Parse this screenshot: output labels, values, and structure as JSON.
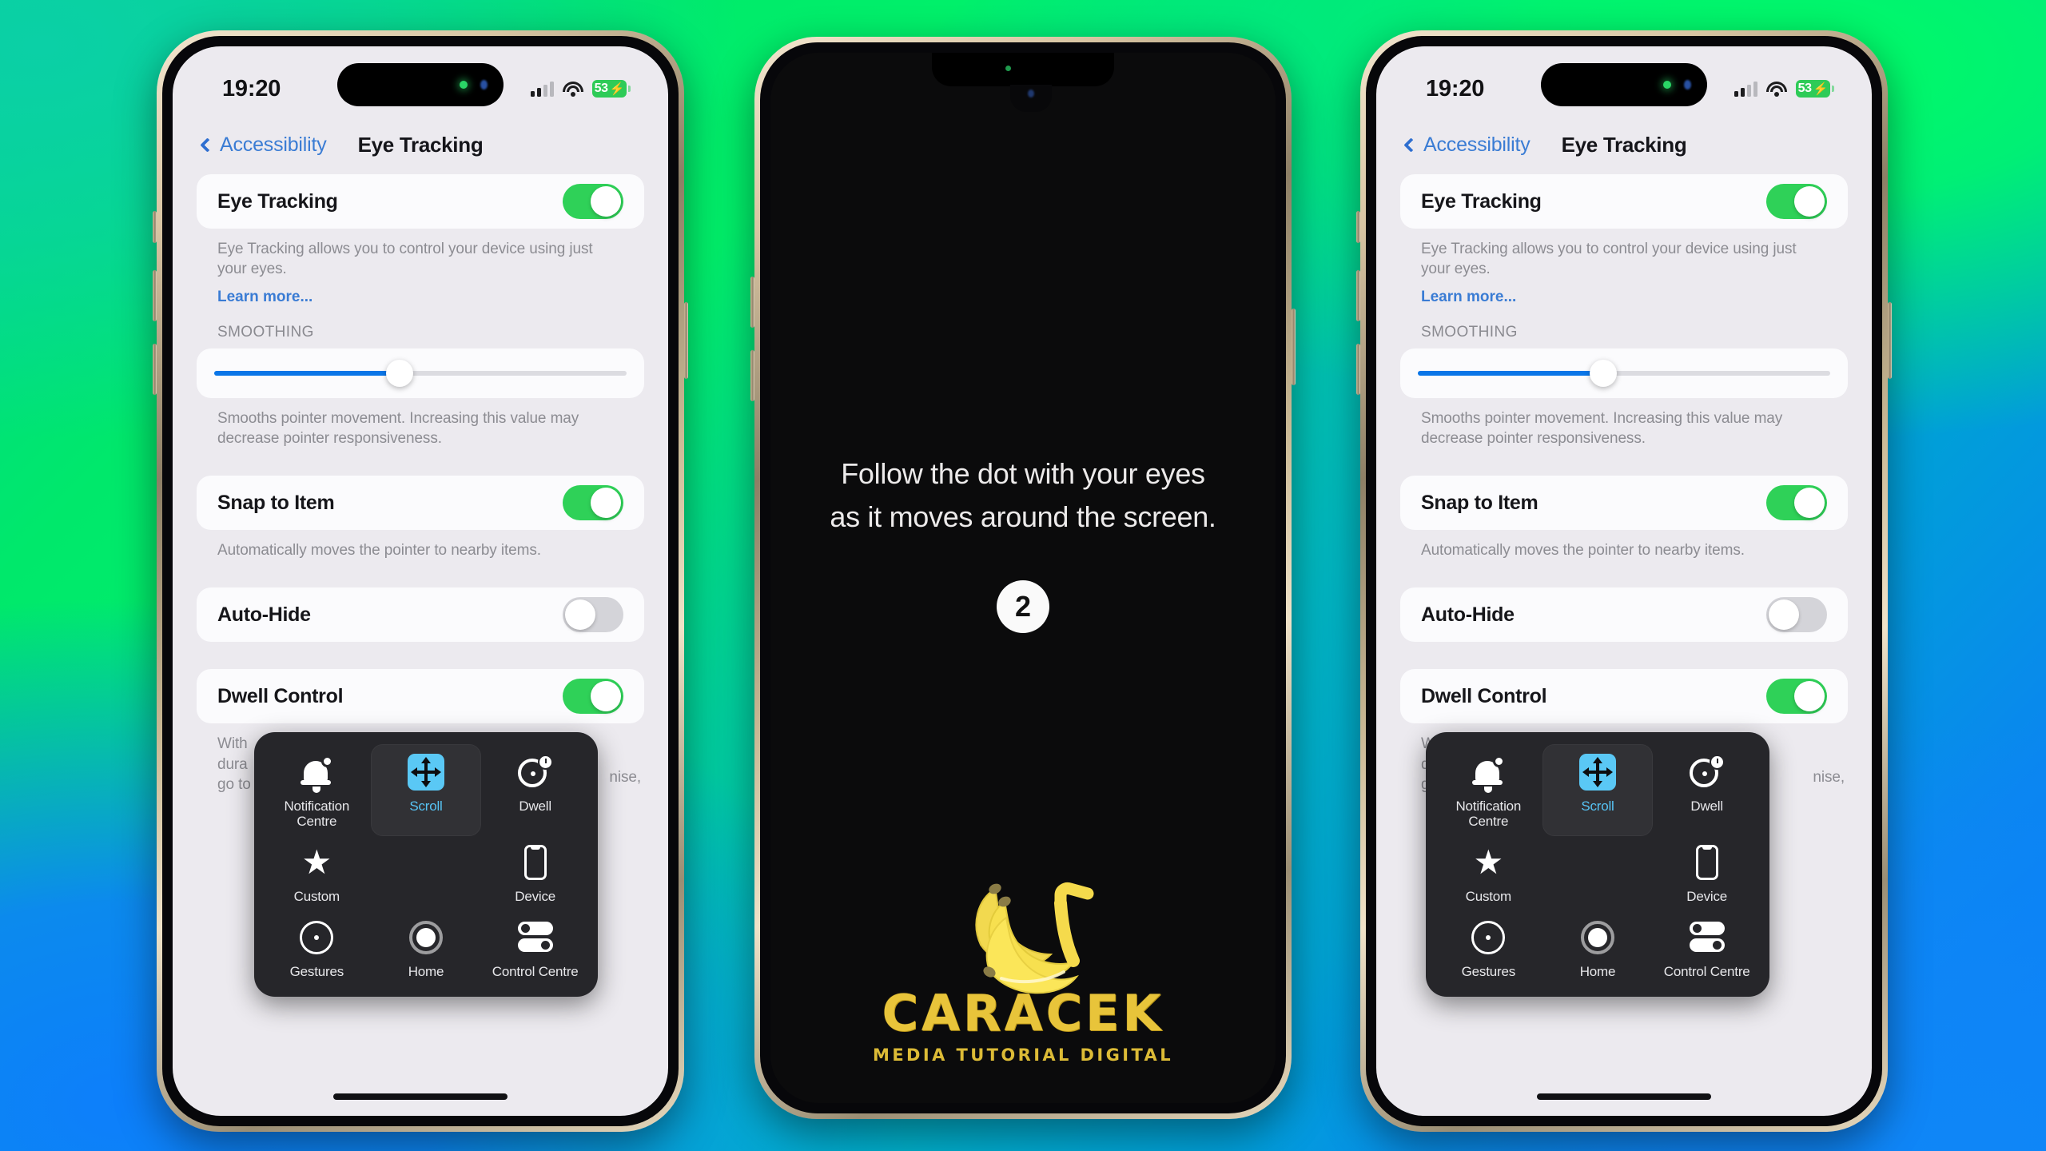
{
  "background": {
    "gradient_from": "#00f06a",
    "gradient_via": "#00b6c4",
    "gradient_to": "#077bfb"
  },
  "status_bar": {
    "time": "19:20",
    "battery_percent": "53",
    "battery_bolt": "⚡",
    "battery_color": "#2ecb57",
    "signal_icon": "cellular-signal-icon",
    "wifi_icon": "wifi-icon"
  },
  "nav": {
    "back_label": "Accessibility",
    "title": "Eye Tracking",
    "back_icon": "chevron-left-icon",
    "accent_color": "#3a7cd4"
  },
  "settings": {
    "eye_tracking": {
      "label": "Eye Tracking",
      "toggle_state": "on",
      "description": "Eye Tracking allows you to control your device using just your eyes.",
      "learn_more": "Learn more..."
    },
    "smoothing": {
      "header": "SMOOTHING",
      "value_percent": 45,
      "fill_color": "#0a76e8",
      "description": "Smooths pointer movement. Increasing this value may decrease pointer responsiveness."
    },
    "snap_to_item": {
      "label": "Snap to Item",
      "toggle_state": "on",
      "description": "Automatically moves the pointer to nearby items."
    },
    "auto_hide": {
      "label": "Auto-Hide",
      "toggle_state": "off"
    },
    "dwell_control": {
      "label": "Dwell Control",
      "toggle_state": "on",
      "description_line1": "With",
      "description_line2": "dura",
      "description_line3": "go to",
      "description_tail": "nise,"
    }
  },
  "assistive_menu": {
    "items": [
      {
        "label": "Notification Centre",
        "icon": "bell-icon",
        "selected": false
      },
      {
        "label": "Scroll",
        "icon": "scroll-arrows-icon",
        "selected": true
      },
      {
        "label": "Dwell",
        "icon": "dwell-timer-icon",
        "selected": false
      },
      {
        "label": "Custom",
        "icon": "star-icon",
        "selected": false
      },
      {
        "label": "",
        "icon": "",
        "selected": false
      },
      {
        "label": "Device",
        "icon": "device-phone-icon",
        "selected": false
      },
      {
        "label": "Gestures",
        "icon": "gestures-circle-icon",
        "selected": false
      },
      {
        "label": "Home",
        "icon": "home-button-icon",
        "selected": false
      },
      {
        "label": "Control Centre",
        "icon": "control-centre-toggles-icon",
        "selected": false
      }
    ],
    "selected_color": "#57c4f5"
  },
  "calibration": {
    "line1": "Follow the dot with your eyes",
    "line2": "as it moves around the screen.",
    "dot_number": "2"
  },
  "watermark": {
    "brand": "CARACEK",
    "tagline": "MEDIA TUTORIAL DIGITAL",
    "logo_icon": "bananas-icon",
    "brand_color": "#e8c43a"
  }
}
